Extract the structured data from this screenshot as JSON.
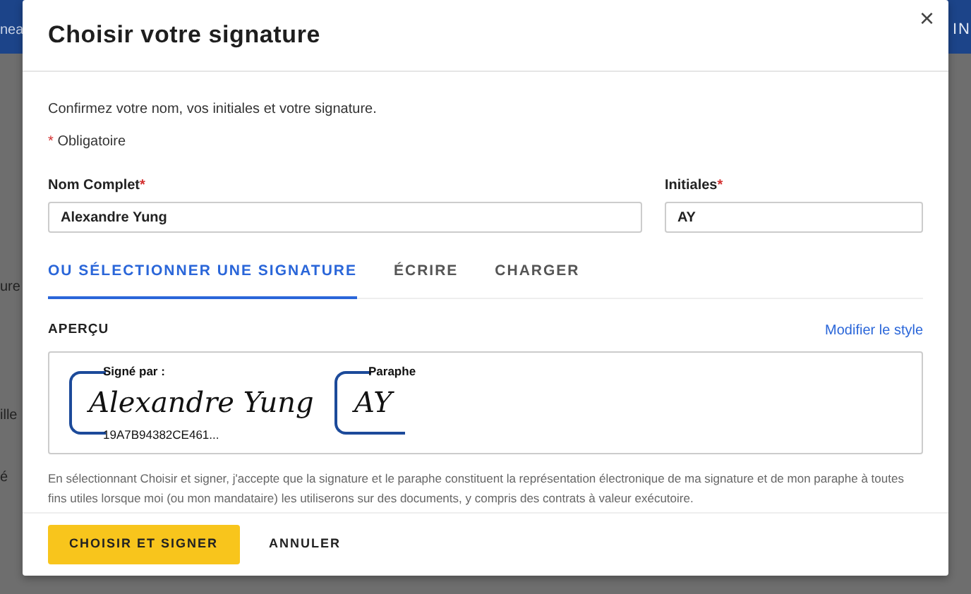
{
  "background": {
    "top_left": "nea",
    "top_right": "IN",
    "side_texts": [
      "ure",
      "ille",
      "é"
    ]
  },
  "dialog": {
    "title": "Choisir votre signature",
    "close": "×",
    "intro": "Confirmez votre nom, vos initiales et votre signature.",
    "required_mark": "*",
    "required_note": "Obligatoire",
    "fields": [
      {
        "label": "Nom Complet",
        "required": true,
        "value": "Alexandre Yung"
      },
      {
        "label": "Initiales",
        "required": true,
        "value": "AY"
      }
    ],
    "tabs": [
      {
        "label": "OU SÉLECTIONNER UNE SIGNATURE",
        "selected": true
      },
      {
        "label": "ÉCRIRE",
        "selected": false
      },
      {
        "label": "CHARGER",
        "selected": false
      }
    ],
    "preview": {
      "title": "APERÇU",
      "link": "Modifier le style",
      "signature": {
        "caption": "Signé par :",
        "script": "Alexandre Yung",
        "code": "19A7B94382CE461..."
      },
      "initials": {
        "caption": "Paraphe",
        "script": "AY"
      }
    },
    "legal": "En sélectionnant Choisir et signer, j'accepte que la signature et le paraphe constituent la représentation électronique de ma signature et de mon paraphe à toutes fins utiles lorsque moi (ou mon mandataire) les utiliserons sur des documents, y compris des contrats à valeur exécutoire.",
    "buttons": [
      {
        "label": "CHOISIR ET SIGNER",
        "kind": "primary"
      },
      {
        "label": "ANNULER",
        "kind": "link"
      }
    ]
  }
}
